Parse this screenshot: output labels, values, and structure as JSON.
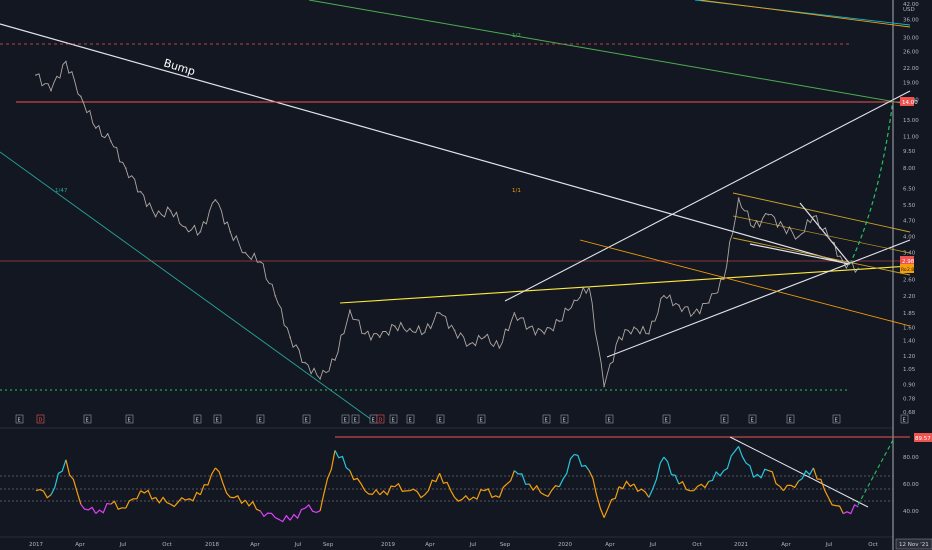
{
  "chart_data": [
    {
      "type": "line",
      "name": "price",
      "ylim": [
        0.68,
        42.0
      ],
      "log_scale": true,
      "y_ticks": [
        "USD",
        "42.00",
        "36.00",
        "30.00",
        "26.00",
        "22.00",
        "19.00",
        "16.00",
        "13.00",
        "11.00",
        "9.50",
        "8.00",
        "6.50",
        "5.50",
        "4.70",
        "4.00",
        "3.40",
        "2.60",
        "2.20",
        "1.85",
        "1.60",
        "1.40",
        "1.20",
        "1.05",
        "0.90",
        "0.78",
        "0.68"
      ],
      "y_tick_values": [
        42,
        36,
        30,
        26,
        22,
        19,
        16,
        13,
        11,
        9.5,
        8,
        6.5,
        5.5,
        4.7,
        4,
        3.4,
        2.6,
        2.2,
        1.85,
        1.6,
        1.4,
        1.2,
        1.05,
        0.9,
        0.78,
        0.68
      ],
      "x_ticks": [
        "2017",
        "Apr",
        "Jul",
        "Oct",
        "2018",
        "Apr",
        "Jul",
        "Sep",
        "2019",
        "Apr",
        "Jul",
        "Sep",
        "2020",
        "Apr",
        "Jul",
        "Oct",
        "2021",
        "Apr",
        "Jul",
        "Oct"
      ],
      "date_label": "12 Nov '21",
      "labels": {
        "high_line": "14.00",
        "current_a": "2.98",
        "current_b_tag": "Ro",
        "current_b": "2.83"
      },
      "annotations": {
        "bump": "Bump",
        "green_ratio": "1/2",
        "yellow_ratio": "1/1",
        "teal_ratio": "1/47"
      },
      "series_points": [
        [
          "2017-01",
          20.5
        ],
        [
          "2017-02",
          17.5
        ],
        [
          "2017-03",
          23.5
        ],
        [
          "2017-04",
          16.5
        ],
        [
          "2017-05",
          12.0
        ],
        [
          "2017-06",
          10.5
        ],
        [
          "2017-07",
          8.0
        ],
        [
          "2017-08",
          6.3
        ],
        [
          "2017-09",
          4.9
        ],
        [
          "2017-10",
          5.2
        ],
        [
          "2017-11",
          4.4
        ],
        [
          "2017-12",
          4.2
        ],
        [
          "2018-01",
          5.8
        ],
        [
          "2018-02",
          4.2
        ],
        [
          "2018-03",
          3.4
        ],
        [
          "2018-04",
          3.1
        ],
        [
          "2018-05",
          2.2
        ],
        [
          "2018-06",
          1.45
        ],
        [
          "2018-07",
          1.12
        ],
        [
          "2018-08",
          0.95
        ],
        [
          "2018-09",
          1.15
        ],
        [
          "2018-10",
          1.9
        ],
        [
          "2018-11",
          1.5
        ],
        [
          "2018-12",
          1.45
        ],
        [
          "2019-01",
          1.62
        ],
        [
          "2019-02",
          1.58
        ],
        [
          "2019-03",
          1.52
        ],
        [
          "2019-04",
          1.85
        ],
        [
          "2019-05",
          1.55
        ],
        [
          "2019-06",
          1.35
        ],
        [
          "2019-07",
          1.45
        ],
        [
          "2019-08",
          1.3
        ],
        [
          "2019-09",
          1.85
        ],
        [
          "2019-10",
          1.6
        ],
        [
          "2019-11",
          1.5
        ],
        [
          "2019-12",
          1.7
        ],
        [
          "2020-01",
          2.1
        ],
        [
          "2020-02",
          2.4
        ],
        [
          "2020-03",
          0.88
        ],
        [
          "2020-04",
          1.45
        ],
        [
          "2020-05",
          1.6
        ],
        [
          "2020-06",
          1.5
        ],
        [
          "2020-07",
          2.2
        ],
        [
          "2020-08",
          2.0
        ],
        [
          "2020-09",
          1.85
        ],
        [
          "2020-10",
          2.05
        ],
        [
          "2020-11",
          2.6
        ],
        [
          "2020-12",
          5.9
        ],
        [
          "2021-01",
          4.4
        ],
        [
          "2021-02",
          5.0
        ],
        [
          "2021-03",
          4.4
        ],
        [
          "2021-04",
          4.0
        ],
        [
          "2021-05",
          4.9
        ],
        [
          "2021-06",
          4.0
        ],
        [
          "2021-07",
          3.1
        ],
        [
          "2021-08",
          2.9
        ]
      ],
      "event_markers": [
        "E",
        "D",
        "E",
        "E",
        "E",
        "E",
        "E",
        "E",
        "E",
        "D",
        "E",
        "E",
        "E",
        "E",
        "E",
        "E",
        "E",
        "E",
        "E",
        "E",
        "E",
        "E",
        "E",
        "E",
        "E"
      ]
    },
    {
      "type": "line",
      "name": "oscillator",
      "ylim": [
        28,
        95
      ],
      "y_ticks": [
        "89.57",
        "80.00",
        "60.00",
        "40.00"
      ],
      "y_tick_values": [
        89.57,
        80,
        60,
        40
      ],
      "series_points": [
        [
          "2017-01",
          55
        ],
        [
          "2017-02",
          52
        ],
        [
          "2017-03",
          78
        ],
        [
          "2017-04",
          45
        ],
        [
          "2017-05",
          38
        ],
        [
          "2017-06",
          45
        ],
        [
          "2017-07",
          42
        ],
        [
          "2017-08",
          55
        ],
        [
          "2017-09",
          50
        ],
        [
          "2017-10",
          45
        ],
        [
          "2017-11",
          48
        ],
        [
          "2017-12",
          52
        ],
        [
          "2018-01",
          72
        ],
        [
          "2018-02",
          50
        ],
        [
          "2018-03",
          48
        ],
        [
          "2018-04",
          40
        ],
        [
          "2018-05",
          35
        ],
        [
          "2018-06",
          33
        ],
        [
          "2018-07",
          42
        ],
        [
          "2018-08",
          40
        ],
        [
          "2018-09",
          85
        ],
        [
          "2018-10",
          70
        ],
        [
          "2018-11",
          55
        ],
        [
          "2018-12",
          52
        ],
        [
          "2019-01",
          58
        ],
        [
          "2019-02",
          55
        ],
        [
          "2019-03",
          52
        ],
        [
          "2019-04",
          68
        ],
        [
          "2019-05",
          50
        ],
        [
          "2019-06",
          48
        ],
        [
          "2019-07",
          55
        ],
        [
          "2019-08",
          50
        ],
        [
          "2019-09",
          70
        ],
        [
          "2019-10",
          60
        ],
        [
          "2019-11",
          52
        ],
        [
          "2019-12",
          58
        ],
        [
          "2020-01",
          82
        ],
        [
          "2020-02",
          70
        ],
        [
          "2020-03",
          35
        ],
        [
          "2020-04",
          58
        ],
        [
          "2020-05",
          60
        ],
        [
          "2020-06",
          50
        ],
        [
          "2020-07",
          80
        ],
        [
          "2020-08",
          60
        ],
        [
          "2020-09",
          55
        ],
        [
          "2020-10",
          62
        ],
        [
          "2020-11",
          70
        ],
        [
          "2020-12",
          88
        ],
        [
          "2021-01",
          65
        ],
        [
          "2021-02",
          70
        ],
        [
          "2021-03",
          55
        ],
        [
          "2021-04",
          62
        ],
        [
          "2021-05",
          72
        ],
        [
          "2021-06",
          50
        ],
        [
          "2021-07",
          38
        ],
        [
          "2021-08",
          43
        ]
      ]
    }
  ]
}
